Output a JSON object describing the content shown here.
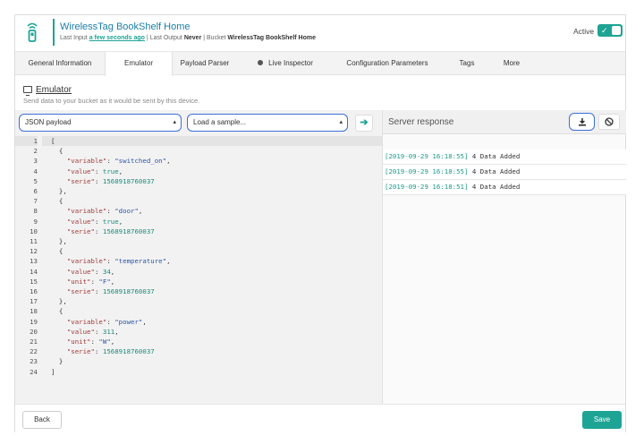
{
  "header": {
    "title": "WirelessTag BookShelf Home",
    "last_input_label": "Last Input",
    "last_input_value": "a few seconds ago",
    "last_output_label": "Last Output",
    "last_output_value": "Never",
    "bucket_label": "Bucket",
    "bucket_value": "WirelessTag BookShelf Home",
    "active_label": "Active",
    "active_on": true,
    "icon": "device-tag-icon"
  },
  "tabs": [
    {
      "label": "General Information",
      "active": false
    },
    {
      "label": "Emulator",
      "active": true
    },
    {
      "label": "Payload Parser",
      "active": false
    },
    {
      "label": "Live Inspector",
      "active": false,
      "dot": true
    },
    {
      "label": "Configuration Parameters",
      "active": false
    },
    {
      "label": "Tags",
      "active": false
    },
    {
      "label": "More",
      "active": false
    }
  ],
  "section": {
    "title": "Emulator",
    "subtitle": "Send data to your bucket as it would be sent by this device."
  },
  "controls": {
    "payload_type": "JSON payload",
    "sample_select": "Load a sample...",
    "send_icon": "arrow-right-icon"
  },
  "editor": {
    "lines": [
      "[",
      "  {",
      "    \"variable\": \"switched_on\",",
      "    \"value\": true,",
      "    \"serie\": 1568918760037",
      "  },",
      "  {",
      "    \"variable\": \"door\",",
      "    \"value\": true,",
      "    \"serie\": 1568918760037",
      "  },",
      "  {",
      "    \"variable\": \"temperature\",",
      "    \"value\": 34,",
      "    \"unit\": \"F\",",
      "    \"serie\": 1568918760037",
      "  },",
      "  {",
      "    \"variable\": \"power\",",
      "    \"value\": 311,",
      "    \"unit\": \"W\",",
      "    \"serie\": 1568918760037",
      "  }",
      "]"
    ]
  },
  "server_response": {
    "title": "Server response",
    "download_icon": "download-icon",
    "clear_icon": "clear-icon",
    "entries": [
      {
        "timestamp": "[2019-09-29 16:18:55]",
        "message": "4 Data Added"
      },
      {
        "timestamp": "[2019-09-29 16:18:55]",
        "message": "4 Data Added"
      },
      {
        "timestamp": "[2019-09-29 16:18:51]",
        "message": "4 Data Added"
      }
    ]
  },
  "footer": {
    "back_label": "Back",
    "save_label": "Save"
  },
  "colors": {
    "accent": "#1ea495",
    "title_blue": "#1a7fa8",
    "focus_outline": "#3b6fd8"
  }
}
